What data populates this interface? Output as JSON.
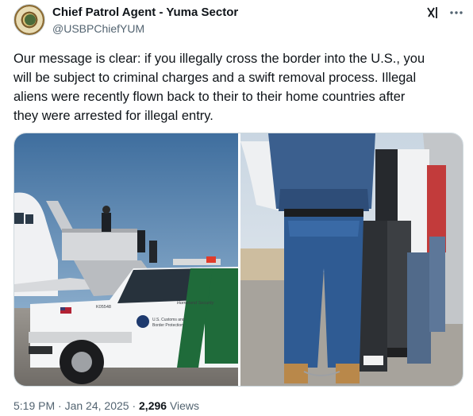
{
  "author": {
    "display_name": "Chief Patrol Agent - Yuma Sector",
    "handle": "@USBPChiefYUM",
    "avatar_icon": "agency-seal-avatar"
  },
  "header_actions": {
    "grok_icon": "grok-icon",
    "more_icon": "more-options-icon"
  },
  "tweet": {
    "text": "Our message is clear: if you illegally cross the border into the U.S., you\nwill be subject to criminal charges and a swift removal process. Illegal\naliens were recently flown back to their to their home countries after\nthey were arrested for illegal entry."
  },
  "media": {
    "photo_1": {
      "truck_door_text_1": "Homeland Security",
      "truck_door_text_2": "U.S. Customs and",
      "truck_door_text_3": "Border Protection",
      "truck_unit": "K05548"
    },
    "photo_2": {}
  },
  "meta": {
    "time": "5:19 PM",
    "separator": "·",
    "date": "Jan 24, 2025",
    "views_count": "2,296",
    "views_label": "Views"
  },
  "colors": {
    "text_primary": "#0f1419",
    "text_secondary": "#536471",
    "border": "#cfd9de",
    "cbp_green": "#1f6b3a"
  }
}
